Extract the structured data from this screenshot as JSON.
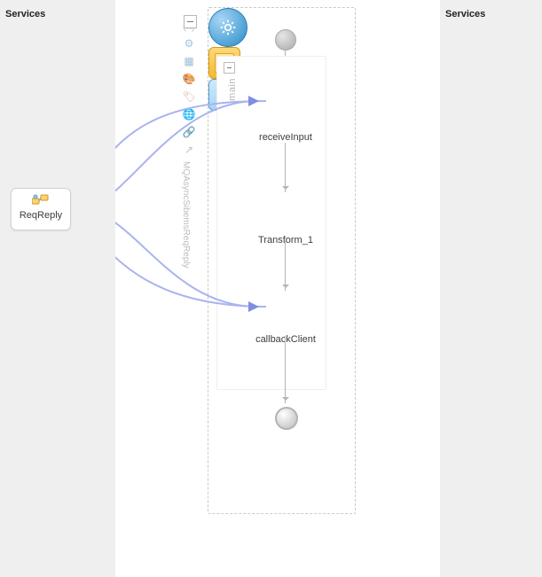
{
  "left": {
    "title": "Services"
  },
  "right": {
    "title": "Services"
  },
  "flow": {
    "receive_label": "receiveInput",
    "transform_label": "Transform_1",
    "callback_label": "callbackClient",
    "subframe_label": "main"
  },
  "partner": {
    "label": "ReqReply"
  },
  "palette": {
    "label": "MQAsyncSibemsReqReply",
    "icons": [
      {
        "name": "variable-icon",
        "char": "(x)",
        "color": "#b9c4cc"
      },
      {
        "name": "gear-icon",
        "char": "⚙",
        "color": "#9dc6e6"
      },
      {
        "name": "table-icon",
        "char": "▦",
        "color": "#9bbfd8"
      },
      {
        "name": "palette-icon",
        "char": "🎨",
        "color": "#e6a3a3"
      },
      {
        "name": "tag-icon",
        "char": "🏷",
        "color": "#d7aea0"
      },
      {
        "name": "globe-icon",
        "char": "🌐",
        "color": "#9fcab6"
      },
      {
        "name": "link-icon",
        "char": "🔗",
        "color": "#b9b9c7"
      },
      {
        "name": "share-icon",
        "char": "↗",
        "color": "#c2c2c2"
      }
    ]
  },
  "chart_data": {
    "type": "flow",
    "framework": "BPEL composite",
    "subframe": "main",
    "nodes": [
      {
        "id": "start",
        "kind": "start"
      },
      {
        "id": "receiveInput",
        "kind": "receive",
        "label": "receiveInput"
      },
      {
        "id": "Transform_1",
        "kind": "transform",
        "label": "Transform_1"
      },
      {
        "id": "callbackClient",
        "kind": "invoke",
        "label": "callbackClient"
      },
      {
        "id": "end",
        "kind": "end"
      }
    ],
    "edges": [
      {
        "from": "start",
        "to": "receiveInput"
      },
      {
        "from": "receiveInput",
        "to": "Transform_1"
      },
      {
        "from": "Transform_1",
        "to": "callbackClient"
      },
      {
        "from": "callbackClient",
        "to": "end"
      }
    ],
    "partner_links": [
      {
        "id": "ReqReply",
        "side": "left",
        "label": "ReqReply",
        "connected_to": [
          "receiveInput",
          "callbackClient"
        ]
      }
    ]
  }
}
